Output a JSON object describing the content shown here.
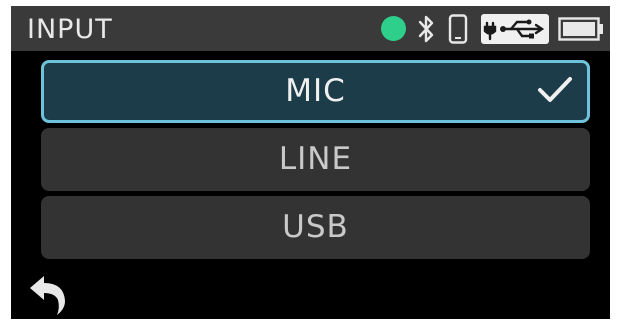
{
  "header": {
    "title": "INPUT",
    "status_icons": [
      "status-dot-icon",
      "bluetooth-icon",
      "phone-icon",
      "usb-power-icon",
      "battery-icon"
    ]
  },
  "options": [
    {
      "label": "MIC",
      "selected": true
    },
    {
      "label": "LINE",
      "selected": false
    },
    {
      "label": "USB",
      "selected": false
    }
  ],
  "footer": {
    "back_icon": "back-arrow-icon"
  },
  "colors": {
    "header_bg": "#3a3a3a",
    "screen_bg": "#000000",
    "option_bg": "#333333",
    "selected_bg": "#1b3c48",
    "selected_border": "#6ec3dc",
    "status_dot": "#2ecf8a"
  }
}
